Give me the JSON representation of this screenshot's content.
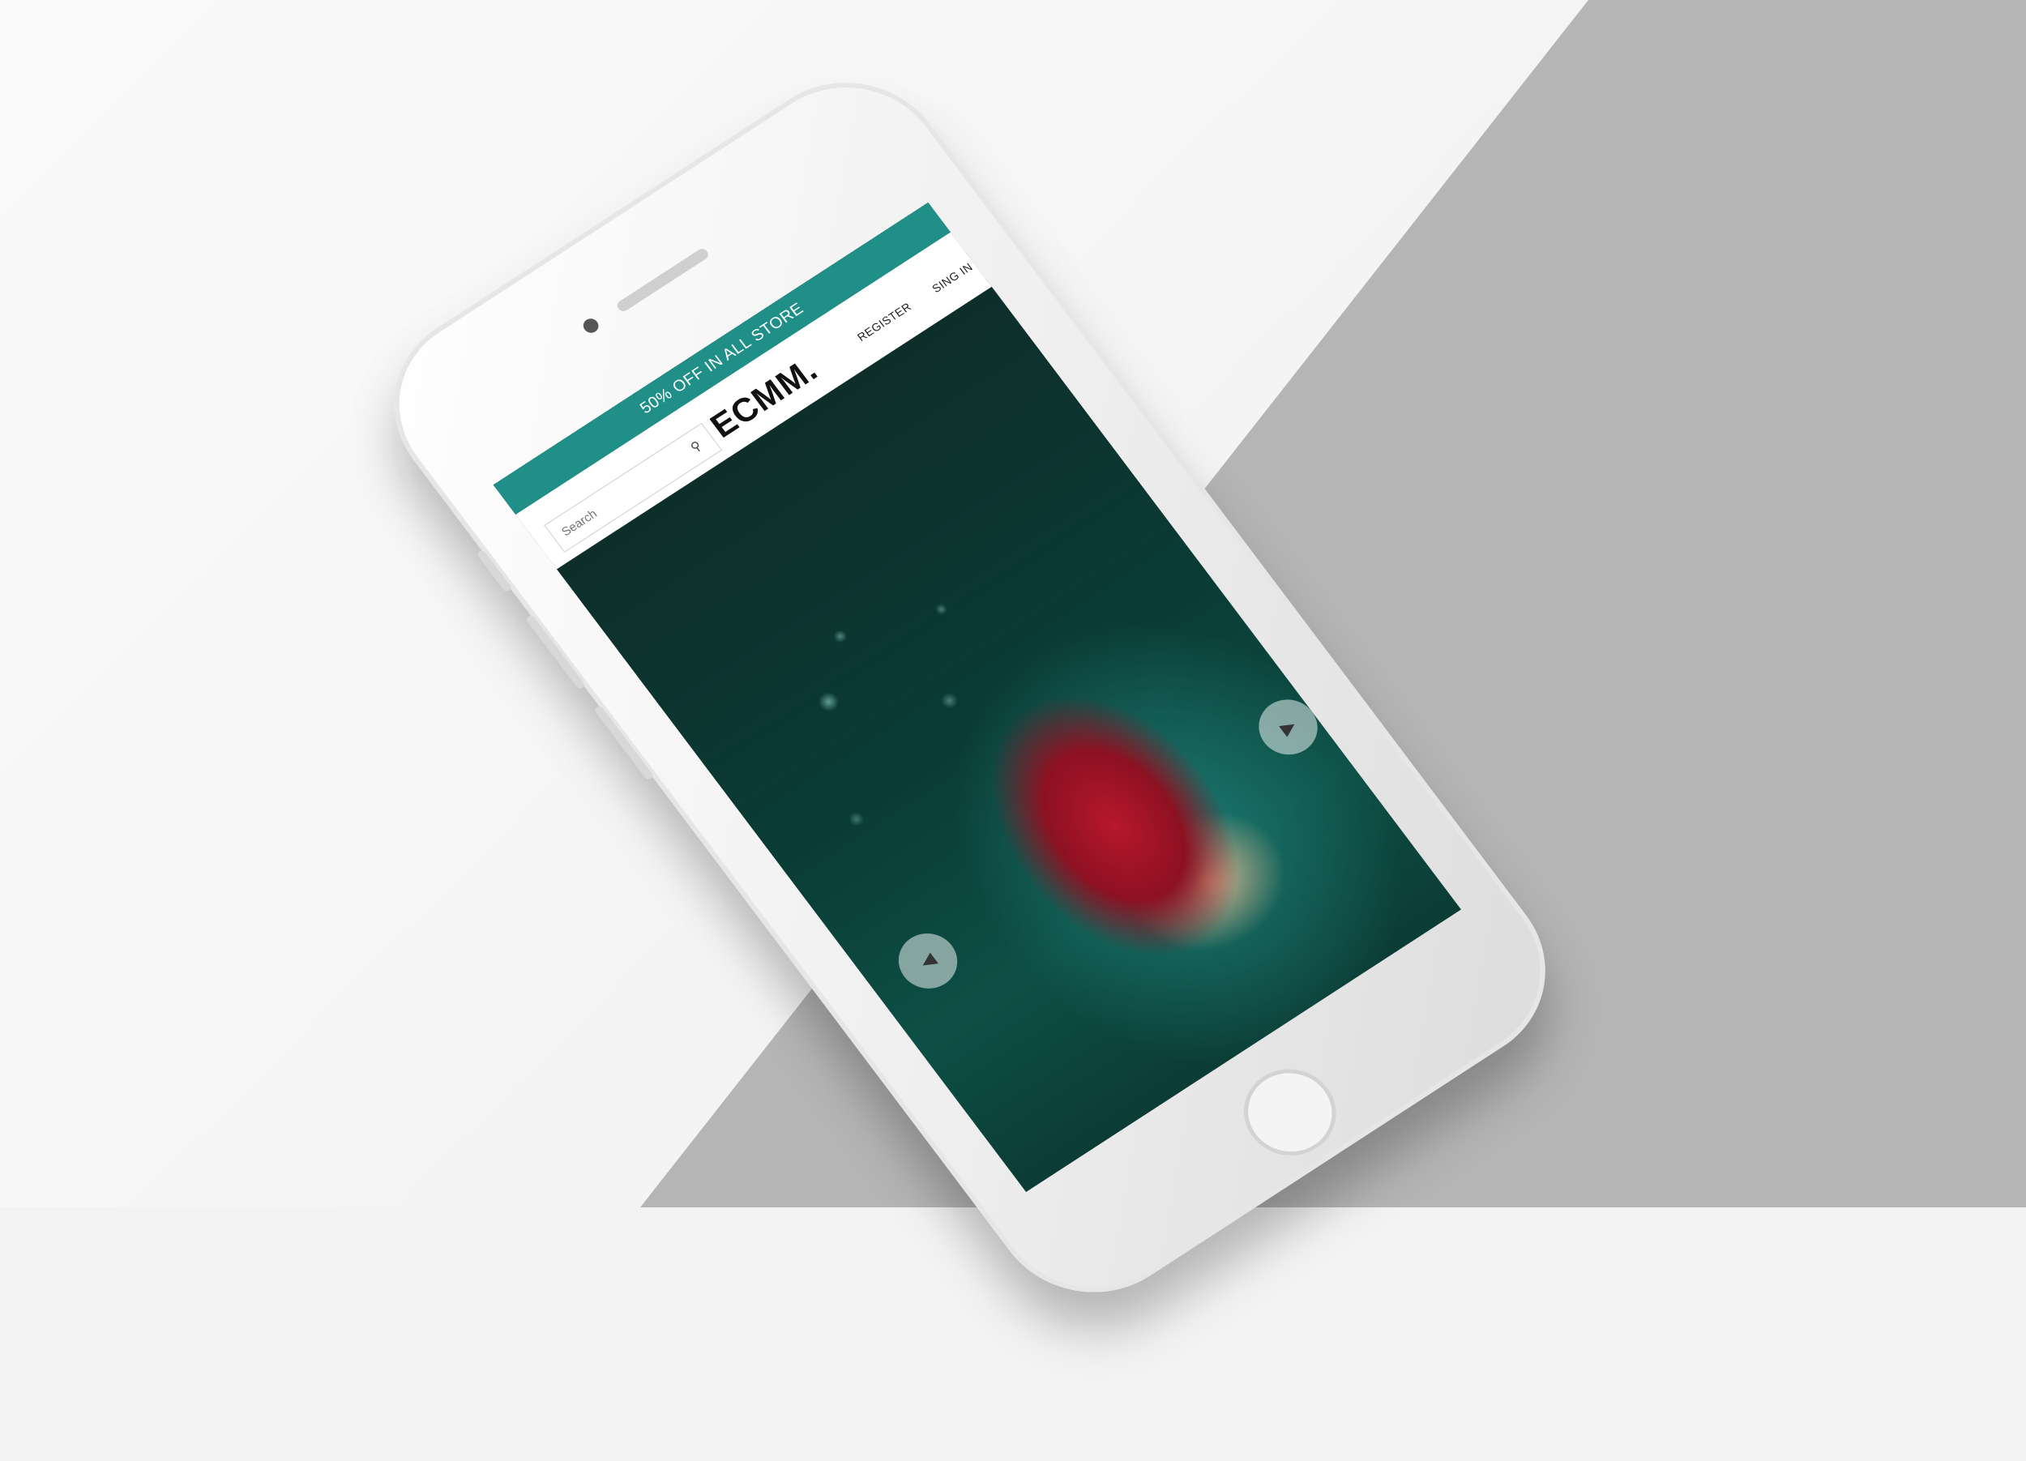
{
  "promo": {
    "text": "50% OFF IN ALL STORE"
  },
  "header": {
    "logo": "ECMM.",
    "search_placeholder": "Search",
    "nav": {
      "register": "REGISTER",
      "signin": "SING IN"
    }
  },
  "hero": {
    "prev_arrow": "◀",
    "next_arrow": "▶"
  }
}
